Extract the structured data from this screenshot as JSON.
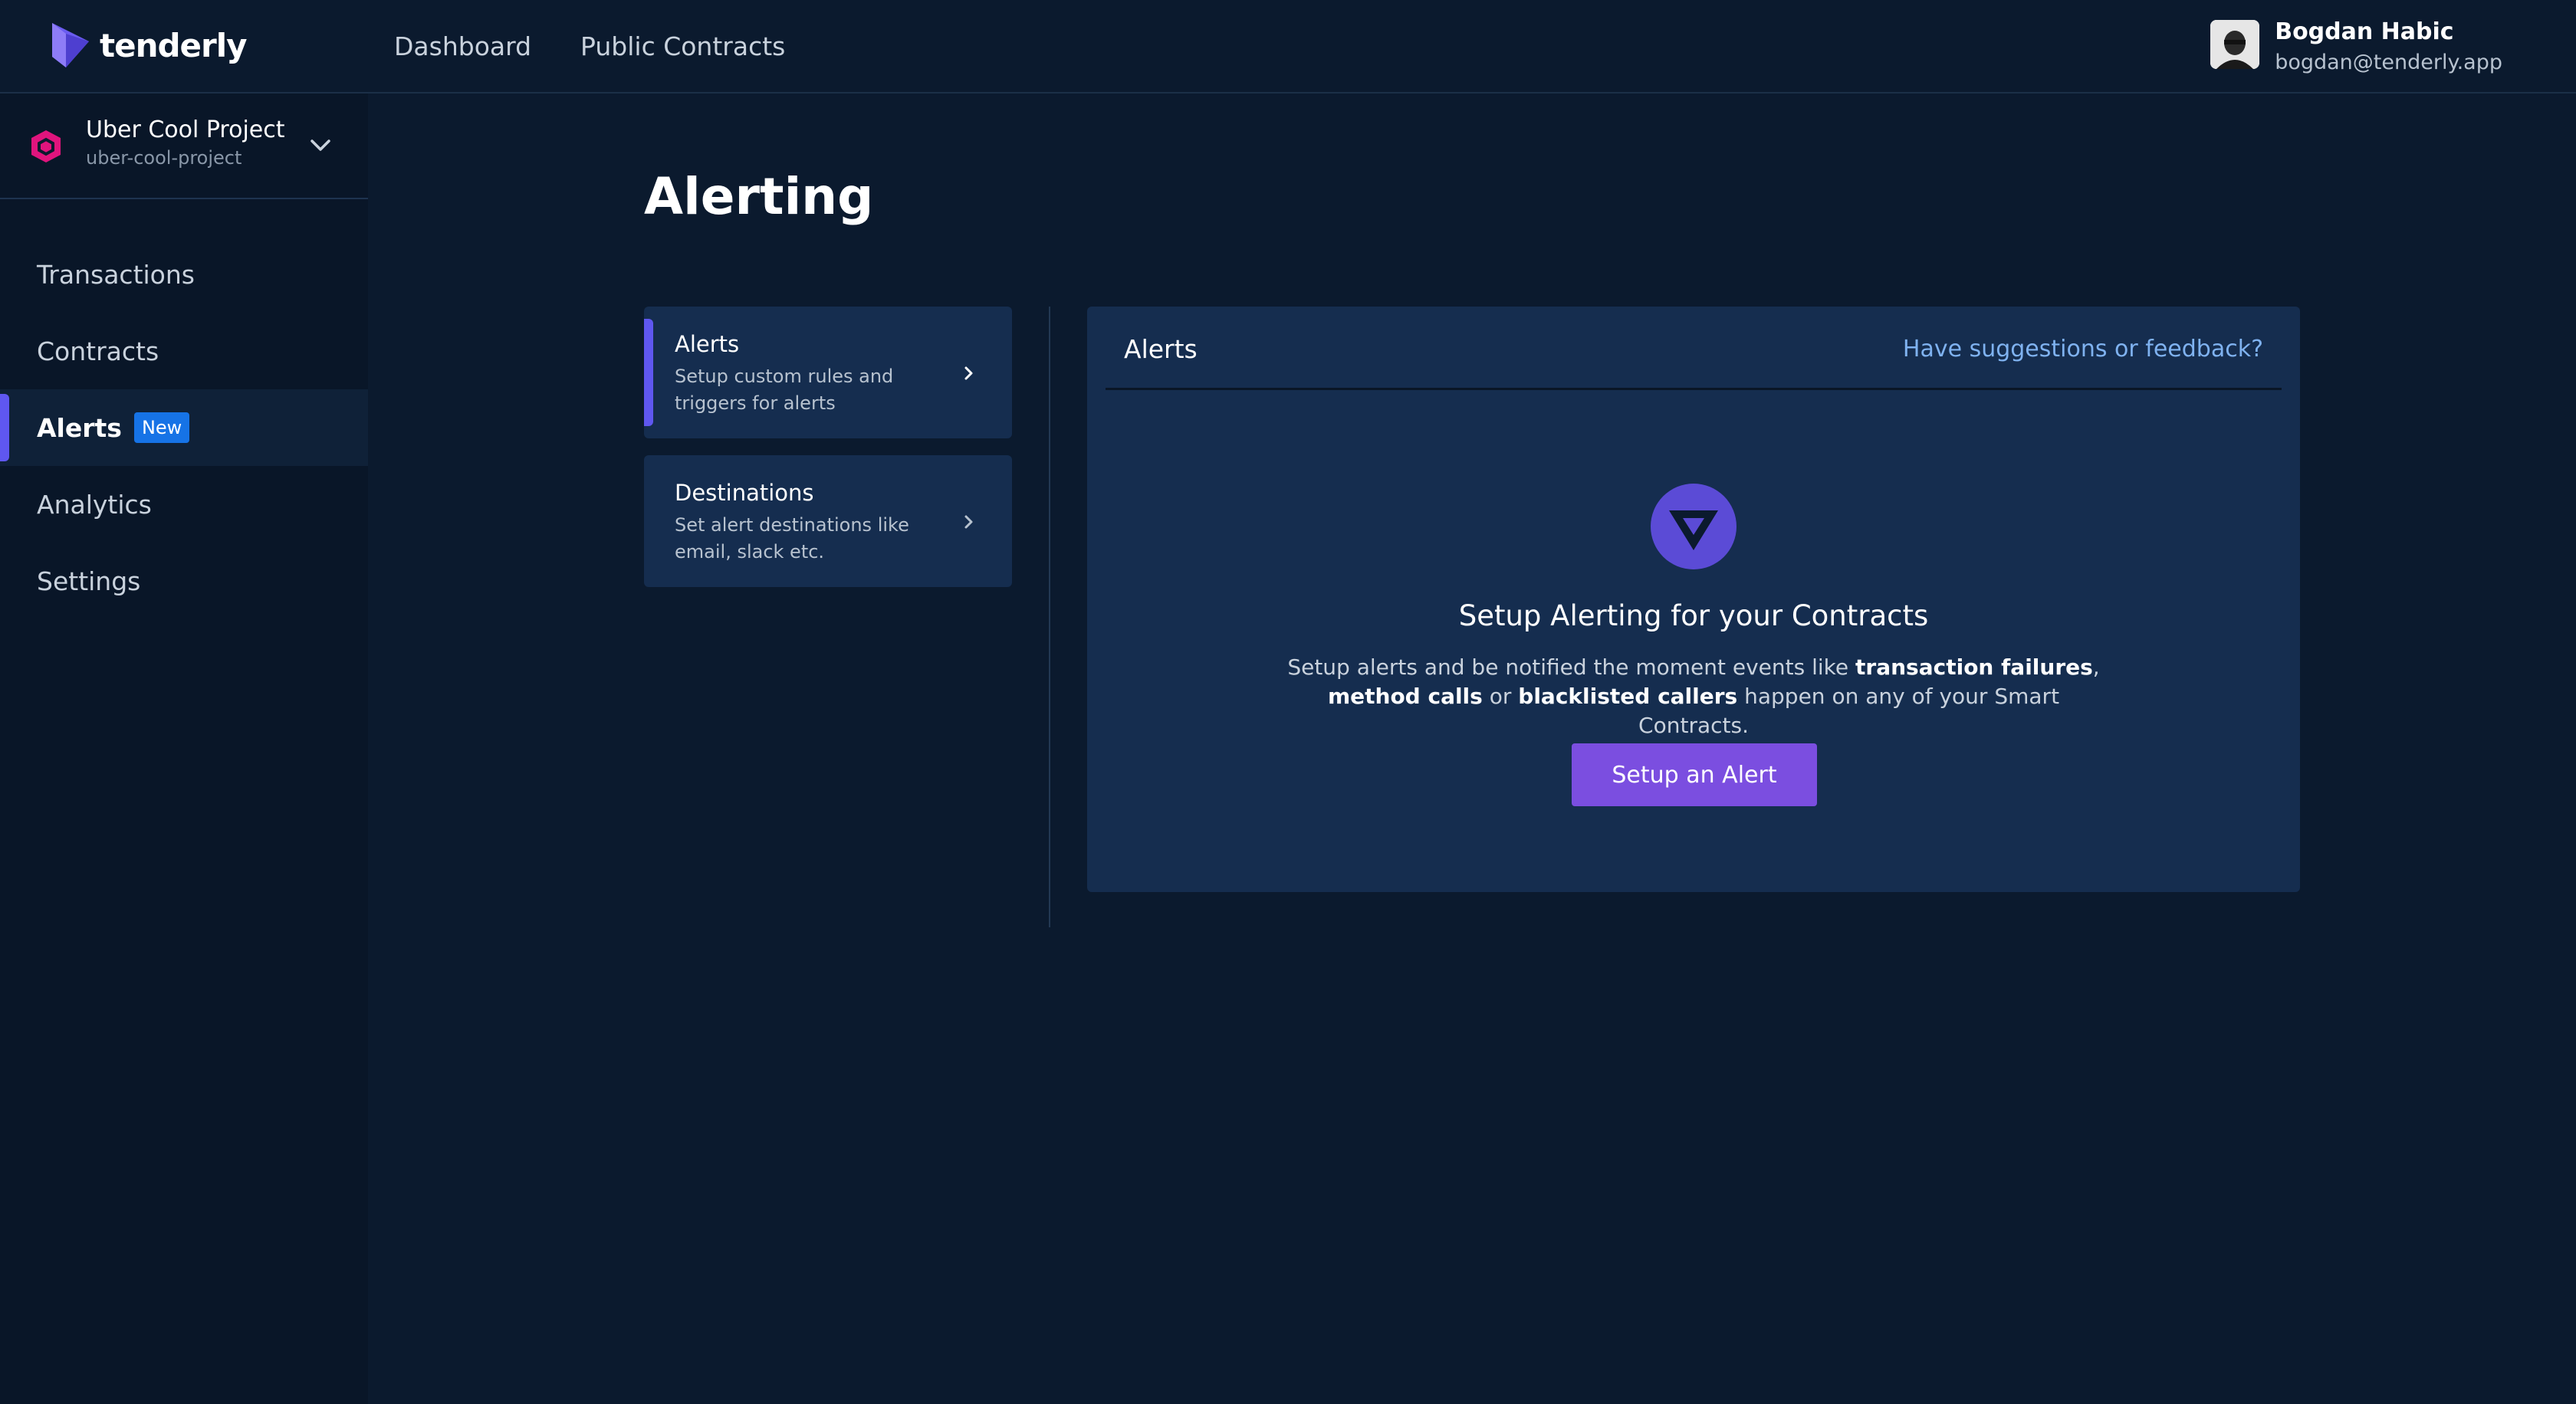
{
  "header": {
    "logo_text": "tenderly",
    "nav": [
      "Dashboard",
      "Public Contracts"
    ],
    "user": {
      "name": "Bogdan Habic",
      "email": "bogdan@tenderly.app"
    }
  },
  "sidebar": {
    "project": {
      "name": "Uber Cool Project",
      "slug": "uber-cool-project",
      "icon": "hexagon-icon",
      "color": "#e0147d"
    },
    "items": [
      {
        "label": "Transactions"
      },
      {
        "label": "Contracts"
      },
      {
        "label": "Alerts",
        "badge": "New",
        "active": true
      },
      {
        "label": "Analytics"
      },
      {
        "label": "Settings"
      }
    ]
  },
  "main": {
    "title": "Alerting",
    "menu": [
      {
        "title": "Alerts",
        "description": "Setup custom rules and triggers for alerts",
        "active": true
      },
      {
        "title": "Destinations",
        "description": "Set alert destinations like email, slack etc."
      }
    ],
    "panel": {
      "title": "Alerts",
      "feedback_link": "Have suggestions or feedback?",
      "empty_state": {
        "icon": "tenderly-triangle-icon",
        "title": "Setup Alerting for your Contracts",
        "desc_1": "Setup alerts and be notified the moment events like ",
        "bold_1": "transaction failures",
        "desc_2": ",",
        "bold_2": "method calls",
        "desc_3": " or ",
        "bold_3": "blacklisted callers",
        "desc_4": " happen on any of your Smart Contracts.",
        "button_label": "Setup an Alert"
      }
    }
  },
  "colors": {
    "background": "#0b1a2e",
    "sidebar": "#091628",
    "card": "#152d4f",
    "accent": "#5f57f0",
    "button": "#7b4ee0",
    "badge": "#1673e6",
    "link": "#7fb2f0"
  }
}
